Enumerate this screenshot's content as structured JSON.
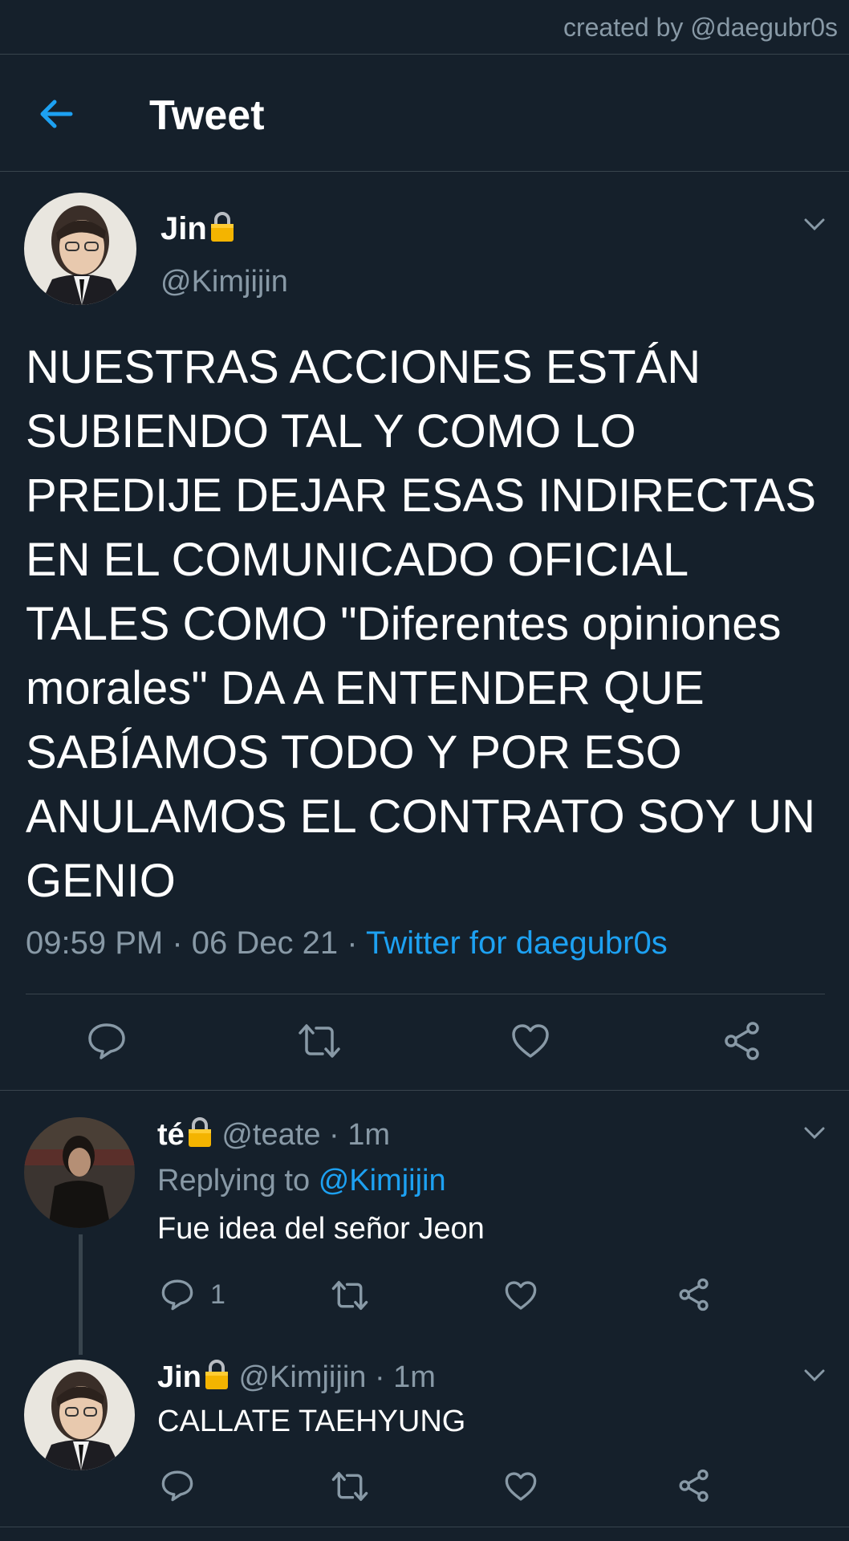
{
  "credit": "created by @daegubr0s",
  "header": {
    "title": "Tweet",
    "back_icon": "arrow-left-icon"
  },
  "main_tweet": {
    "name": "Jin",
    "handle": "@Kimjijin",
    "text": "NUESTRAS ACCIONES ESTÁN SUBIENDO TAL Y COMO LO PREDIJE DEJAR ESAS INDIRECTAS EN EL COMUNICADO OFICIAL TALES COMO \"Diferentes opiniones morales\" DA A ENTENDER QUE SABÍAMOS TODO Y POR ESO ANULAMOS EL CONTRATO SOY UN GENIO",
    "time": "09:59 PM",
    "date": "06 Dec 21",
    "sep": "·",
    "source": "Twitter for daegubr0s"
  },
  "replies": [
    {
      "name": "té",
      "handle": "@teate",
      "sep": "·",
      "time": "1m",
      "replying_prefix": "Replying to",
      "replying_to": "@Kimjijin",
      "text": "Fue idea del señor Jeon",
      "reply_count": "1"
    },
    {
      "name": "Jin",
      "handle": "@Kimjijin",
      "sep": "·",
      "time": "1m",
      "text": "CALLATE TAEHYUNG"
    }
  ],
  "colors": {
    "background": "#15202b",
    "border": "#38444d",
    "muted": "#8899a6",
    "accent": "#1da1f2",
    "lock": "#f4b400"
  }
}
